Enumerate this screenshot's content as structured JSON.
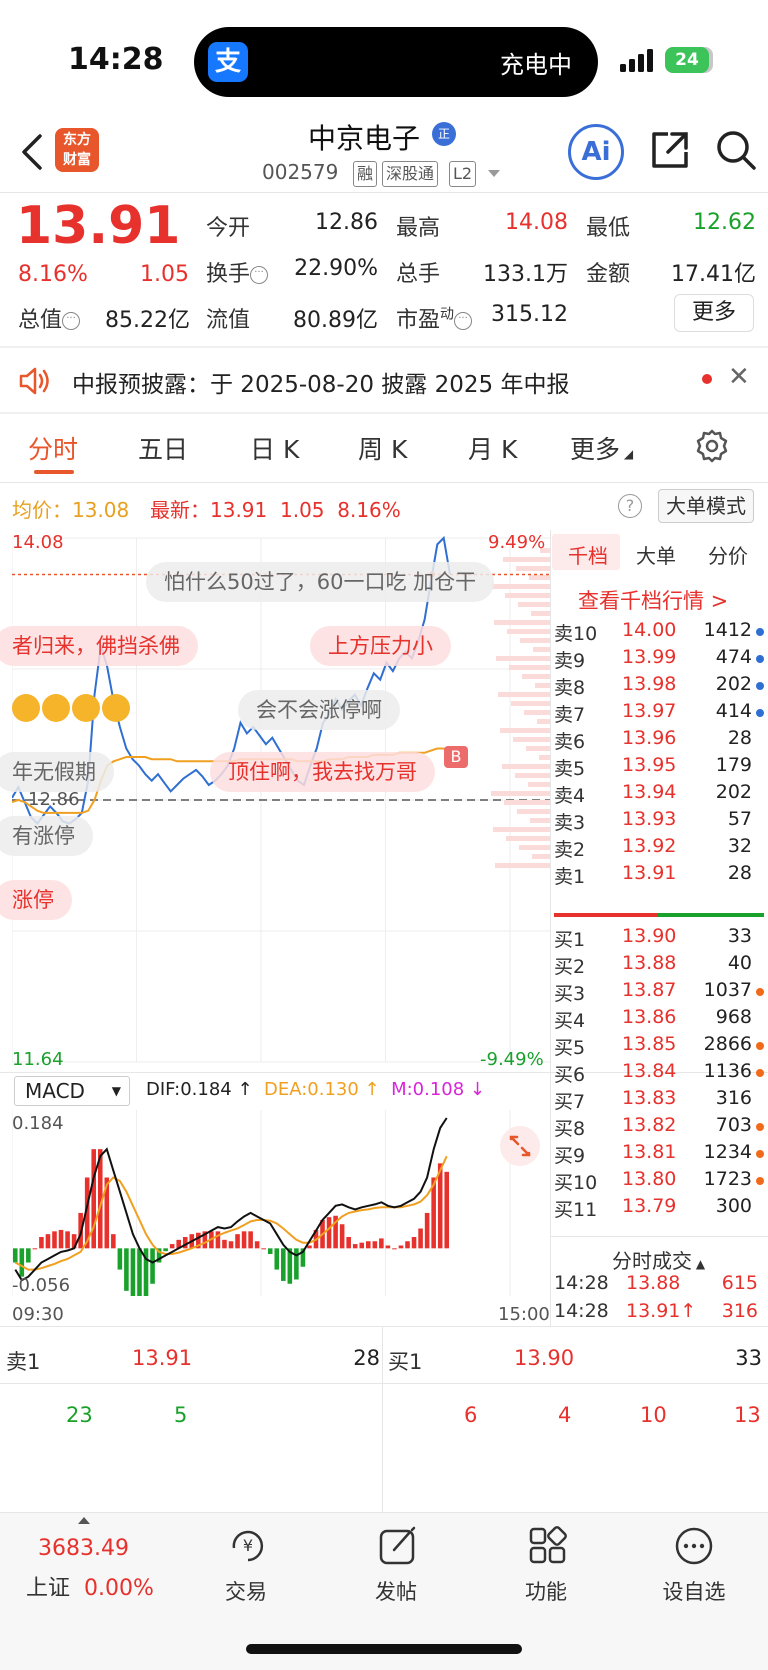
{
  "status": {
    "time": "14:28",
    "island_text": "充电中",
    "battery": "24"
  },
  "header": {
    "stock_name": "中京电子",
    "code": "002579",
    "tags": [
      "融",
      "深股通",
      "L2"
    ],
    "logo_line1": "东方",
    "logo_line2": "财富",
    "name_badge": "正",
    "ai_label": "Ai"
  },
  "quote": {
    "price": "13.91",
    "change_pct": "8.16%",
    "change": "1.05",
    "open_label": "今开",
    "open": "12.86",
    "high_label": "最高",
    "high": "14.08",
    "low_label": "最低",
    "low": "12.62",
    "turnover_label": "换手",
    "turnover": "22.90%",
    "volume_label": "总手",
    "volume": "133.1万",
    "amount_label": "金额",
    "amount": "17.41亿",
    "mktcap_label": "总值",
    "mktcap": "85.22亿",
    "float_label": "流值",
    "float_cap": "80.89亿",
    "pe_label": "市盈",
    "pe_sup": "动",
    "pe": "315.12",
    "more_label": "更多"
  },
  "notice": {
    "text": "中报预披露：于 2025-08-20 披露 2025 年中报"
  },
  "tabs": [
    "分时",
    "五日",
    "日 K",
    "周 K",
    "月 K",
    "更多"
  ],
  "chart_info": {
    "avg_label": "均价：13.08",
    "latest_label": "最新：",
    "latest_price": "13.91",
    "latest_change": "1.05",
    "latest_pct": "8.16%",
    "help": "?",
    "big_order_mode": "大单模式"
  },
  "chart_data": {
    "type": "line",
    "y_max_label": "14.08",
    "y_min_label": "11.64",
    "pct_max_label": "9.49%",
    "pct_min_label": "-9.49%",
    "prev_close_label": "12.86",
    "x_start": "09:30",
    "x_end": "15:00",
    "ylim": [
      11.64,
      14.08
    ],
    "prev_close": 12.86,
    "series": [
      {
        "values": [
          12.87,
          12.92,
          12.85,
          12.78,
          12.75,
          12.79,
          12.83,
          12.8,
          12.76,
          12.75,
          12.77,
          12.8,
          12.95,
          13.35,
          13.58,
          13.48,
          13.32,
          13.2,
          13.1,
          13.05,
          13.02,
          12.98,
          12.95,
          12.98,
          12.94,
          12.9,
          12.93,
          12.96,
          12.98,
          13.0,
          12.97,
          12.93,
          12.95,
          12.98,
          13.02,
          13.1,
          13.22,
          13.17,
          13.2,
          13.16,
          13.12,
          13.15,
          13.1,
          13.05,
          13.0,
          12.95,
          12.93,
          13.02,
          13.1,
          13.22,
          13.26,
          13.33,
          13.28,
          13.32,
          13.35,
          13.3,
          13.38,
          13.45,
          13.42,
          13.5,
          13.46,
          13.52,
          13.55,
          13.52,
          13.6,
          13.7,
          13.88,
          14.05,
          14.08,
          13.91
        ]
      },
      {
        "values": [
          12.85,
          12.86,
          12.85,
          12.83,
          12.81,
          12.8,
          12.8,
          12.8,
          12.8,
          12.8,
          12.8,
          12.8,
          12.81,
          12.86,
          12.95,
          13.02,
          13.04,
          13.05,
          13.06,
          13.06,
          13.06,
          13.06,
          13.05,
          13.05,
          13.05,
          13.05,
          13.04,
          13.04,
          13.04,
          13.04,
          13.04,
          13.04,
          13.04,
          13.04,
          13.04,
          13.04,
          13.05,
          13.05,
          13.05,
          13.05,
          13.05,
          13.05,
          13.05,
          13.05,
          13.05,
          13.04,
          13.04,
          13.04,
          13.04,
          13.04,
          13.05,
          13.05,
          13.05,
          13.06,
          13.06,
          13.06,
          13.06,
          13.07,
          13.07,
          13.07,
          13.07,
          13.08,
          13.08,
          13.08,
          13.08,
          13.08,
          13.09,
          13.1,
          13.1,
          13.08
        ]
      }
    ]
  },
  "comments": [
    "怕什么50过了，60一口吃 加仓干",
    "者归来，佛挡杀佛",
    "上方压力小",
    "会不会涨停啊",
    "年无假期",
    "顶住啊，我去找万哥",
    "有涨停",
    "涨停"
  ],
  "macd": {
    "select": "MACD",
    "dif": "DIF:0.184 ↑",
    "dea": "DEA:0.130 ↑",
    "m": "M:0.108 ↓",
    "top_label": "0.184",
    "bottom_label": "-0.056"
  },
  "macd_data": {
    "type": "line",
    "ylim": [
      -0.056,
      0.184
    ],
    "dif": [
      -0.03,
      -0.045,
      -0.04,
      -0.03,
      -0.02,
      -0.015,
      -0.01,
      -0.005,
      -0.003,
      0.0,
      0.02,
      0.06,
      0.1,
      0.13,
      0.14,
      0.11,
      0.08,
      0.05,
      0.02,
      0.0,
      -0.015,
      -0.02,
      -0.015,
      -0.01,
      -0.005,
      0.0,
      0.005,
      0.01,
      0.015,
      0.02,
      0.025,
      0.03,
      0.028,
      0.03,
      0.038,
      0.045,
      0.05,
      0.045,
      0.04,
      0.035,
      0.02,
      0.005,
      -0.005,
      -0.01,
      -0.005,
      0.01,
      0.025,
      0.04,
      0.05,
      0.06,
      0.062,
      0.058,
      0.055,
      0.058,
      0.06,
      0.062,
      0.065,
      0.06,
      0.058,
      0.06,
      0.065,
      0.07,
      0.08,
      0.1,
      0.14,
      0.17,
      0.184
    ],
    "dea": [
      -0.02,
      -0.025,
      -0.03,
      -0.03,
      -0.028,
      -0.025,
      -0.022,
      -0.018,
      -0.015,
      -0.01,
      -0.005,
      0.01,
      0.03,
      0.06,
      0.09,
      0.1,
      0.095,
      0.08,
      0.06,
      0.04,
      0.02,
      0.005,
      -0.005,
      -0.008,
      -0.008,
      -0.006,
      -0.003,
      0.0,
      0.004,
      0.008,
      0.013,
      0.018,
      0.022,
      0.025,
      0.028,
      0.033,
      0.038,
      0.04,
      0.04,
      0.039,
      0.035,
      0.028,
      0.02,
      0.012,
      0.008,
      0.008,
      0.012,
      0.02,
      0.028,
      0.037,
      0.045,
      0.05,
      0.052,
      0.054,
      0.055,
      0.057,
      0.058,
      0.058,
      0.058,
      0.058,
      0.06,
      0.062,
      0.066,
      0.075,
      0.09,
      0.11,
      0.13
    ],
    "bars": [
      -0.02,
      -0.04,
      -0.02,
      0.0,
      0.016,
      0.02,
      0.024,
      0.026,
      0.024,
      0.02,
      0.05,
      0.1,
      0.14,
      0.14,
      0.1,
      0.02,
      -0.03,
      -0.06,
      -0.08,
      -0.08,
      -0.07,
      -0.05,
      -0.02,
      -0.004,
      0.006,
      0.012,
      0.016,
      0.02,
      0.022,
      0.024,
      0.024,
      0.024,
      0.012,
      0.01,
      0.02,
      0.024,
      0.024,
      0.01,
      0.0,
      -0.008,
      -0.03,
      -0.046,
      -0.05,
      -0.044,
      -0.026,
      0.004,
      0.026,
      0.04,
      0.044,
      0.046,
      0.034,
      0.016,
      0.006,
      0.008,
      0.01,
      0.01,
      0.014,
      0.004,
      0.0,
      0.004,
      0.01,
      0.016,
      0.028,
      0.05,
      0.1,
      0.12,
      0.108
    ]
  },
  "orderbook": {
    "tabs": [
      "千档",
      "大单",
      "分价"
    ],
    "link": "查看千档行情 >",
    "asks": [
      {
        "name": "卖10",
        "price": "14.00",
        "vol": "1412",
        "dot": "#2f6fd1"
      },
      {
        "name": "卖9",
        "price": "13.99",
        "vol": "474",
        "dot": "#2f6fd1"
      },
      {
        "name": "卖8",
        "price": "13.98",
        "vol": "202",
        "dot": "#2f6fd1"
      },
      {
        "name": "卖7",
        "price": "13.97",
        "vol": "414",
        "dot": "#2f6fd1"
      },
      {
        "name": "卖6",
        "price": "13.96",
        "vol": "28",
        "dot": ""
      },
      {
        "name": "卖5",
        "price": "13.95",
        "vol": "179",
        "dot": ""
      },
      {
        "name": "卖4",
        "price": "13.94",
        "vol": "202",
        "dot": ""
      },
      {
        "name": "卖3",
        "price": "13.93",
        "vol": "57",
        "dot": ""
      },
      {
        "name": "卖2",
        "price": "13.92",
        "vol": "32",
        "dot": ""
      },
      {
        "name": "卖1",
        "price": "13.91",
        "vol": "28",
        "dot": ""
      }
    ],
    "bids": [
      {
        "name": "买1",
        "price": "13.90",
        "vol": "33",
        "dot": ""
      },
      {
        "name": "买2",
        "price": "13.88",
        "vol": "40",
        "dot": ""
      },
      {
        "name": "买3",
        "price": "13.87",
        "vol": "1037",
        "dot": "#f06a1a"
      },
      {
        "name": "买4",
        "price": "13.86",
        "vol": "968",
        "dot": ""
      },
      {
        "name": "买5",
        "price": "13.85",
        "vol": "2866",
        "dot": "#f06a1a"
      },
      {
        "name": "买6",
        "price": "13.84",
        "vol": "1136",
        "dot": "#f06a1a"
      },
      {
        "name": "买7",
        "price": "13.83",
        "vol": "316",
        "dot": ""
      },
      {
        "name": "买8",
        "price": "13.82",
        "vol": "703",
        "dot": "#f06a1a"
      },
      {
        "name": "买9",
        "price": "13.81",
        "vol": "1234",
        "dot": "#f06a1a"
      },
      {
        "name": "买10",
        "price": "13.80",
        "vol": "1723",
        "dot": "#f06a1a"
      },
      {
        "name": "买11",
        "price": "13.79",
        "vol": "300",
        "dot": ""
      }
    ],
    "trades_title": "分时成交",
    "trades": [
      {
        "time": "14:28",
        "price": "13.88",
        "vol": "615"
      },
      {
        "time": "14:28",
        "price": "13.91↑",
        "vol": "316"
      }
    ]
  },
  "bottom_quote": {
    "ask_label": "卖1",
    "ask_price": "13.91",
    "ask_vol": "28",
    "bid_label": "买1",
    "bid_price": "13.90",
    "bid_vol": "33",
    "left_nums": [
      "23",
      "5"
    ],
    "right_nums": [
      "6",
      "4",
      "10",
      "13"
    ]
  },
  "nav": {
    "index_value": "3683.49",
    "index_name": "上证",
    "index_pct": "0.00%",
    "items": [
      "交易",
      "发帖",
      "功能",
      "设自选"
    ]
  },
  "colors": {
    "up": "#e6312d",
    "down": "#1aa12c",
    "price_line": "#2f6fd1",
    "avg_line": "#f0a020",
    "brand": "#e8562b"
  }
}
